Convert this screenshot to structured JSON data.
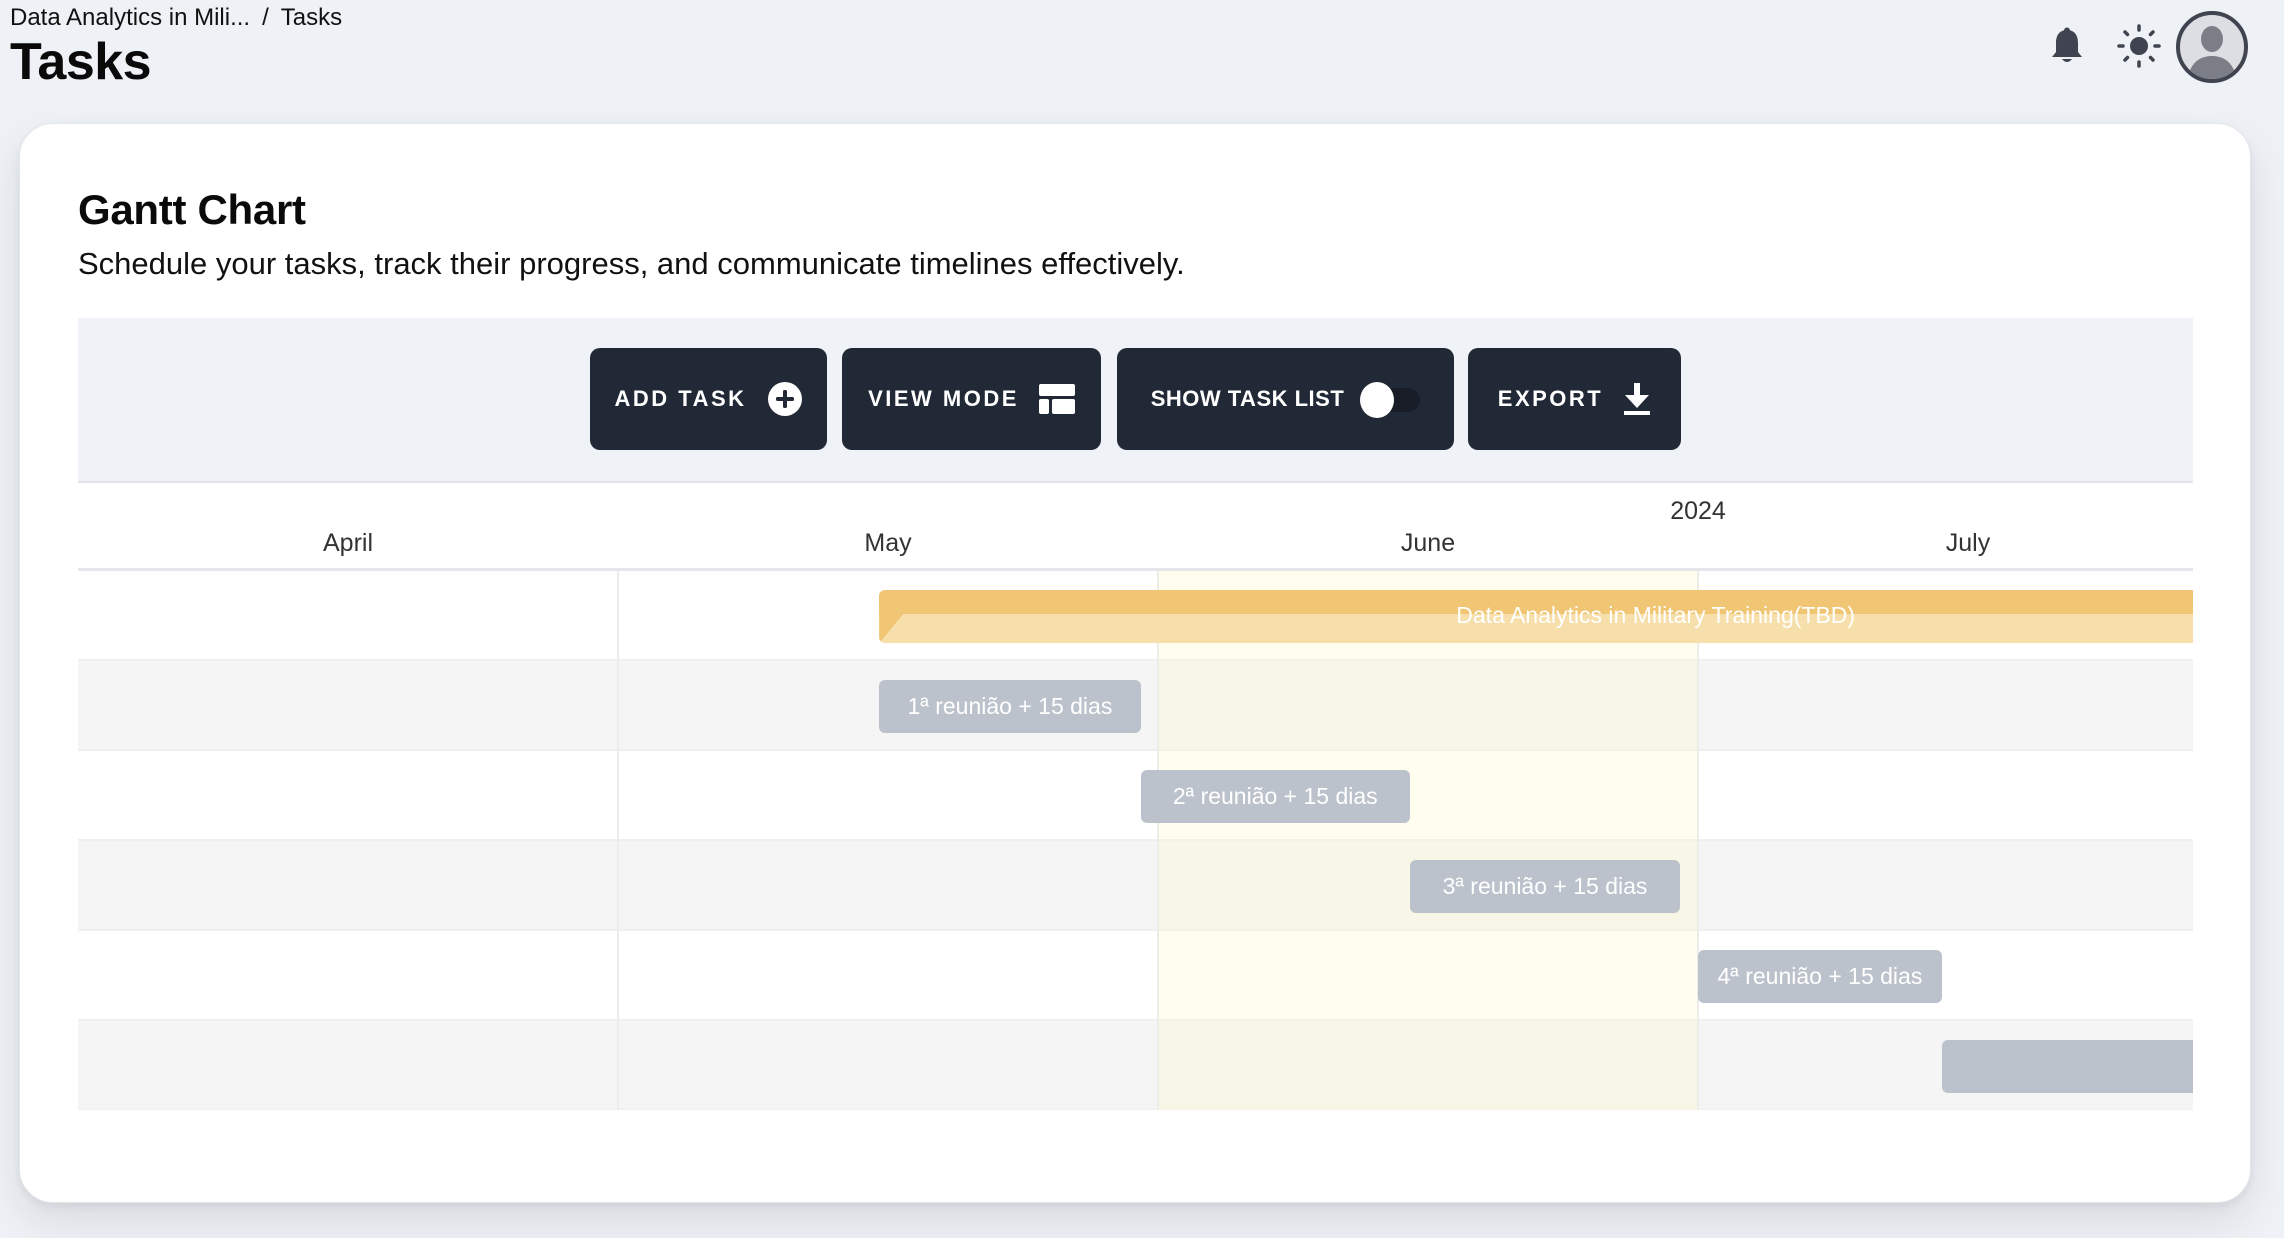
{
  "breadcrumb": {
    "items": [
      "Data Analytics in Mili...",
      "Tasks"
    ],
    "separator": "/"
  },
  "page": {
    "title": "Tasks"
  },
  "header_icons": {
    "notifications": "bell-icon",
    "theme": "sun-icon",
    "profile": "avatar"
  },
  "card": {
    "title": "Gantt Chart",
    "subtitle": "Schedule your tasks, track their progress, and communicate timelines effectively."
  },
  "toolbar": {
    "add_task": "ADD TASK",
    "view_mode": "VIEW MODE",
    "show_task_list": "SHOW TASK LIST",
    "show_task_list_on": false,
    "export": "EXPORT"
  },
  "colors": {
    "button_bg": "#222936",
    "project_bar": "#f0c675",
    "project_bar_light": "#f6dfab",
    "task_bar": "#bcc2cb",
    "today_highlight": "#fcf8c8"
  },
  "chart_data": {
    "type": "gantt",
    "year_label": "2024",
    "months": [
      "April",
      "May",
      "June",
      "July"
    ],
    "highlighted_month": "June",
    "timeline_start": "2024-04-01",
    "timeline_end": "2024-07-31",
    "tasks": [
      {
        "name": "Data Analytics in Military Training(TBD)",
        "type": "project",
        "start": "2024-05-16",
        "end": "2024-07-31",
        "label_visible": true
      },
      {
        "name": "1ª reunião + 15 dias",
        "type": "task",
        "start": "2024-05-16",
        "end": "2024-05-31",
        "label_visible": true
      },
      {
        "name": "2ª reunião + 15 dias",
        "type": "task",
        "start": "2024-05-31",
        "end": "2024-06-15",
        "label_visible": true
      },
      {
        "name": "3ª reunião + 15 dias",
        "type": "task",
        "start": "2024-06-15",
        "end": "2024-06-30",
        "label_visible": true
      },
      {
        "name": "4ª reunião + 15 dias",
        "type": "task",
        "start": "2024-07-01",
        "end": "2024-07-15",
        "label_visible": true
      },
      {
        "name": "",
        "type": "task",
        "start": "2024-07-15",
        "end": "2024-07-31",
        "label_visible": false
      }
    ]
  }
}
